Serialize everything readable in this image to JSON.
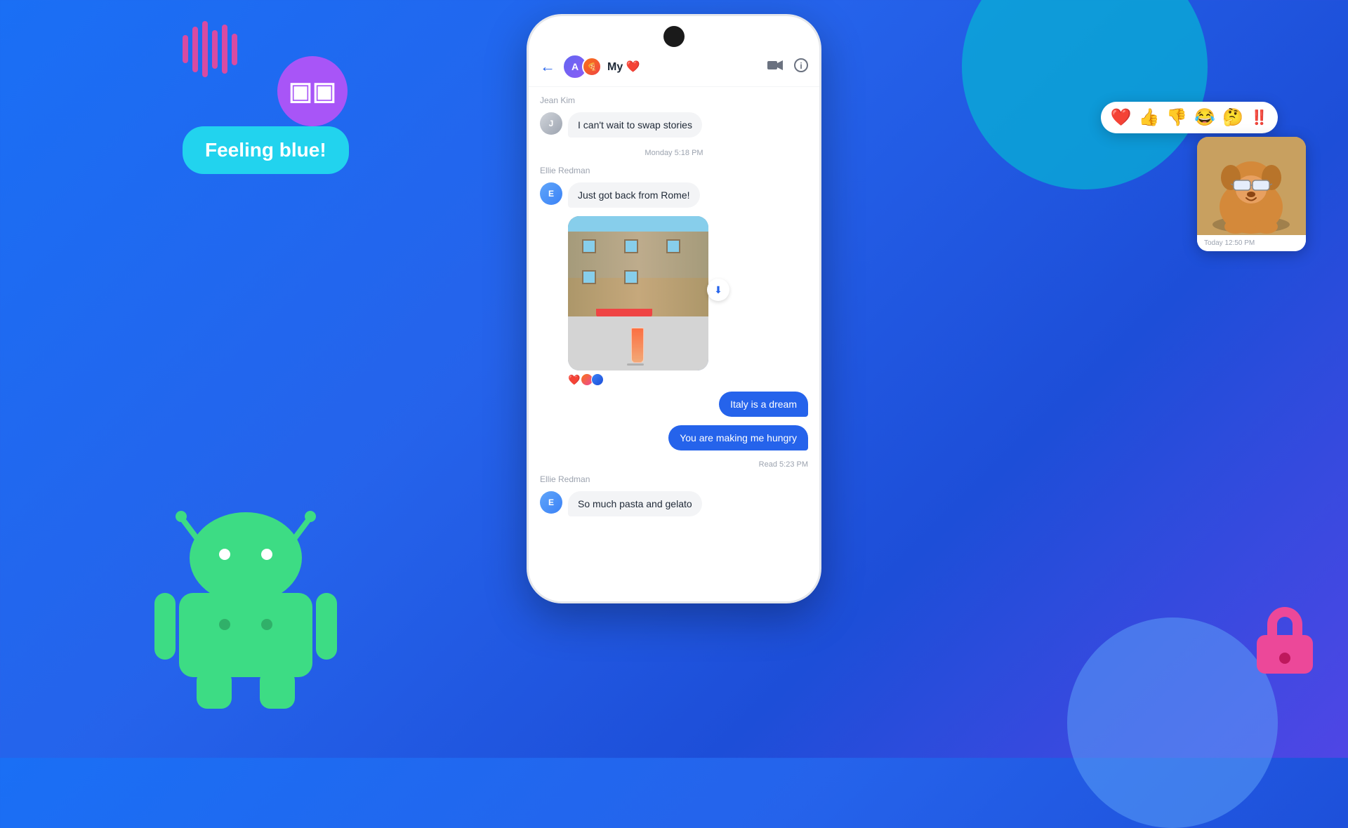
{
  "background": {
    "gradient_start": "#1a6ff5",
    "gradient_end": "#4f46e5"
  },
  "decorative": {
    "feeling_blue_text": "Feeling blue!",
    "sound_wave_label": "sound-wave-bars"
  },
  "phone": {
    "header": {
      "back_label": "←",
      "chat_name": "My ❤️",
      "emoji_a": "A",
      "emoji_pizza": "🍕",
      "video_icon": "▭",
      "info_icon": "ℹ"
    },
    "messages": [
      {
        "type": "sender_label",
        "text": "Jean Kim"
      },
      {
        "type": "received",
        "text": "I can't wait to swap stories",
        "sender": "JK"
      },
      {
        "type": "timestamp",
        "text": "Monday 5:18 PM"
      },
      {
        "type": "sender_label",
        "text": "Ellie Redman"
      },
      {
        "type": "received",
        "text": "Just got back from Rome!",
        "sender": "ER"
      },
      {
        "type": "image",
        "alt": "Rome photo with drink"
      },
      {
        "type": "sent",
        "text": "Italy is a dream"
      },
      {
        "type": "sent",
        "text": "You are making me hungry"
      },
      {
        "type": "read_receipt",
        "text": "Read  5:23 PM"
      },
      {
        "type": "sender_label",
        "text": "Ellie Redman"
      },
      {
        "type": "received",
        "text": "So much pasta and gelato",
        "sender": "ER"
      }
    ]
  },
  "emoji_bar": {
    "emojis": [
      "❤️",
      "👍",
      "👎",
      "😂",
      "🤔",
      "‼️"
    ]
  },
  "dog_card": {
    "timestamp": "Today  12:50 PM",
    "alt": "Cute dog with sunglasses"
  }
}
